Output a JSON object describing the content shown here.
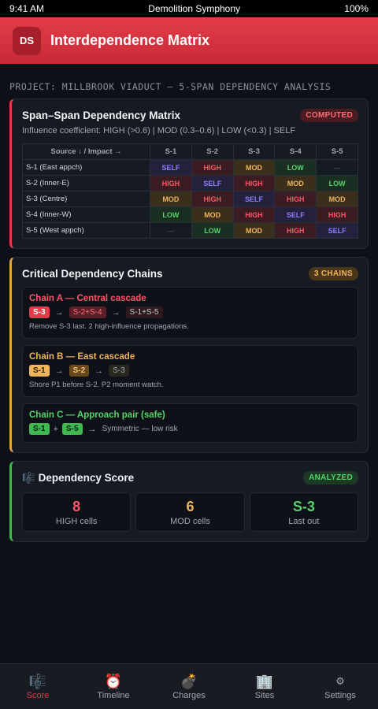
{
  "status": {
    "time": "9:41 AM",
    "title": "Demolition Symphony",
    "battery": "100%"
  },
  "header": {
    "logo": "DS",
    "title": "Interdependence Matrix"
  },
  "project": "PROJECT: MILLBROOK VIADUCT — 5-SPAN DEPENDENCY ANALYSIS",
  "matrix_card": {
    "title": "Span–Span Dependency Matrix",
    "badge": "COMPUTED",
    "subtitle": "Influence coefficient: HIGH (>0.6) | MOD (0.3–0.6) | LOW (<0.3) | SELF",
    "corner": "Source ↓ / Impact →",
    "columns": [
      "S-1",
      "S-2",
      "S-3",
      "S-4",
      "S-5"
    ],
    "rows": [
      {
        "label": "S-1 (East appch)",
        "cells": [
          "SELF",
          "HIGH",
          "MOD",
          "LOW",
          "—"
        ]
      },
      {
        "label": "S-2 (Inner-E)",
        "cells": [
          "HIGH",
          "SELF",
          "HIGH",
          "MOD",
          "LOW"
        ]
      },
      {
        "label": "S-3 (Centre)",
        "cells": [
          "MOD",
          "HIGH",
          "SELF",
          "HIGH",
          "MOD"
        ]
      },
      {
        "label": "S-4 (Inner-W)",
        "cells": [
          "LOW",
          "MOD",
          "HIGH",
          "SELF",
          "HIGH"
        ]
      },
      {
        "label": "S-5 (West appch)",
        "cells": [
          "—",
          "LOW",
          "MOD",
          "HIGH",
          "SELF"
        ]
      }
    ]
  },
  "chains_card": {
    "title": "Critical Dependency Chains",
    "badge": "3 CHAINS",
    "chains": [
      {
        "title": "Chain A — Central cascade",
        "color": "#ff5566",
        "chips": [
          "S-3",
          "S-2+S-4",
          "S-1+S-5"
        ],
        "note": "Remove S-3 last. 2 high-influence propagations."
      },
      {
        "title": "Chain B — East cascade",
        "color": "#f0b45a",
        "chips": [
          "S-1",
          "S-2",
          "S-3"
        ],
        "note": "Shore P1 before S-2. P2 moment watch."
      },
      {
        "title": "Chain C — Approach pair (safe)",
        "color": "#56d36a",
        "chips": [
          "S-1",
          "S-5"
        ],
        "joiner": "+",
        "note": "Symmetric — low risk"
      }
    ]
  },
  "score_card": {
    "icon": "🎼",
    "title": "Dependency Score",
    "badge": "ANALYZED",
    "tiles": [
      {
        "value": "8",
        "label": "HIGH cells",
        "color": "#ff5566"
      },
      {
        "value": "6",
        "label": "MOD cells",
        "color": "#f0b45a"
      },
      {
        "value": "S-3",
        "label": "Last out",
        "color": "#56d36a"
      }
    ]
  },
  "tabs": [
    {
      "icon": "🎼",
      "label": "Score",
      "active": true
    },
    {
      "icon": "⏰",
      "label": "Timeline",
      "active": false
    },
    {
      "icon": "💣",
      "label": "Charges",
      "active": false
    },
    {
      "icon": "🏢",
      "label": "Sites",
      "active": false
    },
    {
      "icon": "⚙",
      "label": "Settings",
      "active": false
    }
  ]
}
